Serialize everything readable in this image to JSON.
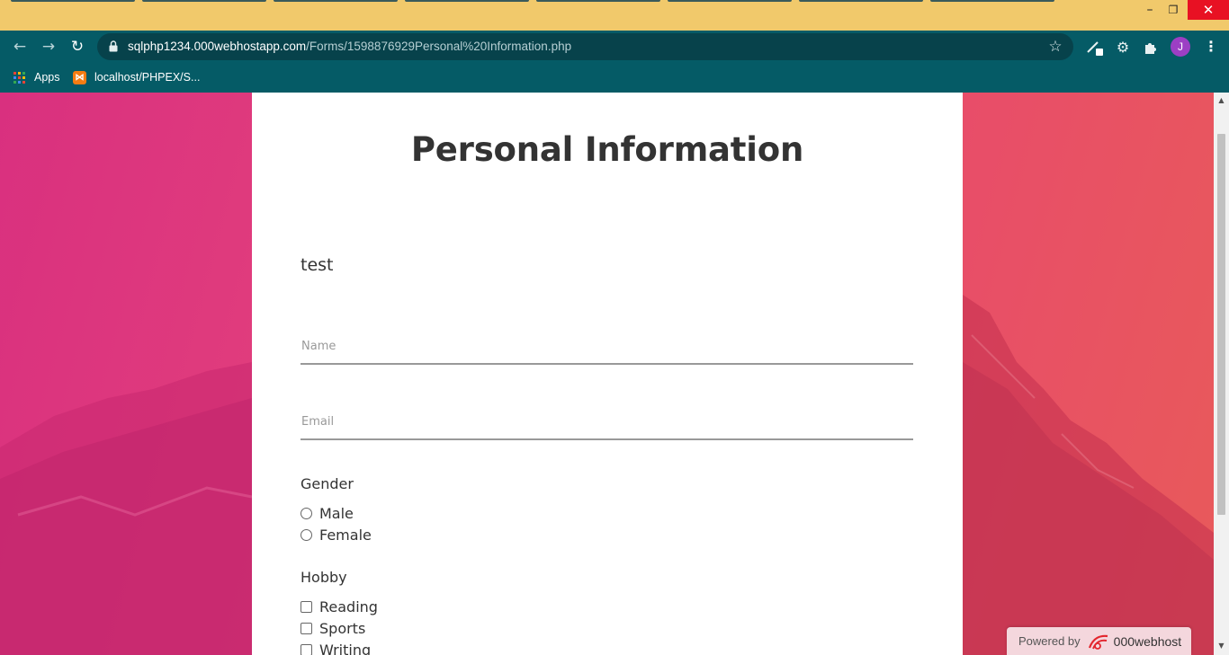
{
  "window": {
    "controls": {
      "minimize": "–",
      "restore": "❐",
      "close": "✕"
    }
  },
  "toolbar": {
    "url_host": "sqlphp1234.000webhostapp.com",
    "url_path": "/Forms/1598876929Personal%20Information.php",
    "avatar_initial": "J"
  },
  "bookmarks": [
    {
      "label": "Apps",
      "icon": "apps-grid-icon"
    },
    {
      "label": "localhost/PHPEX/S...",
      "icon": "xampp-icon"
    }
  ],
  "form": {
    "title": "Personal Information",
    "description": "test",
    "name_placeholder": "Name",
    "email_placeholder": "Email",
    "gender": {
      "label": "Gender",
      "options": [
        "Male",
        "Female"
      ]
    },
    "hobby": {
      "label": "Hobby",
      "options": [
        "Reading",
        "Sports",
        "Writing"
      ]
    }
  },
  "badge": {
    "powered_by": "Powered by",
    "brand": "000webhost"
  },
  "colors": {
    "title_bar": "#f1c96b",
    "toolbar": "#055b66",
    "omnibox": "#07424b",
    "background_gradient_start": "#d9307f",
    "background_gradient_end": "#e85a5a",
    "card": "#ffffff",
    "text": "#333333"
  }
}
